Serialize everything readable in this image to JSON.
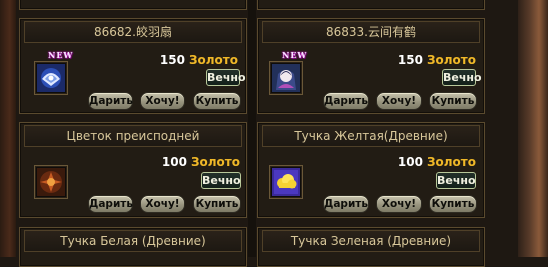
{
  "cards": [
    {
      "title": "86682.皎羽扇",
      "is_new": true,
      "new_label": "NEW",
      "price": "150",
      "currency": "Золото",
      "term": "Вечно",
      "buttons": {
        "gift": "Дарить",
        "want": "Хочу!",
        "buy": "Купить"
      },
      "icon": "fan-icon"
    },
    {
      "title": "86833.云间有鹤",
      "is_new": true,
      "new_label": "NEW",
      "price": "150",
      "currency": "Золото",
      "term": "Вечно",
      "buttons": {
        "gift": "Дарить",
        "want": "Хочу!",
        "buy": "Купить"
      },
      "icon": "crane-portrait-icon"
    },
    {
      "title": "Цветок преисподней",
      "is_new": false,
      "price": "100",
      "currency": "Золото",
      "term": "Вечно",
      "buttons": {
        "gift": "Дарить",
        "want": "Хочу!",
        "buy": "Купить"
      },
      "icon": "underworld-flower-icon"
    },
    {
      "title": "Тучка Желтая(Древние)",
      "is_new": false,
      "price": "100",
      "currency": "Золото",
      "term": "Вечно",
      "buttons": {
        "gift": "Дарить",
        "want": "Хочу!",
        "buy": "Купить"
      },
      "icon": "yellow-cloud-icon"
    },
    {
      "title": "Тучка Белая (Древние)",
      "icon": ""
    },
    {
      "title": "Тучка Зеленая (Древние)",
      "icon": ""
    }
  ],
  "colors": {
    "currency": "#f0b828",
    "title_text": "#d8c79a",
    "panel_border": "#5a4a2e"
  }
}
